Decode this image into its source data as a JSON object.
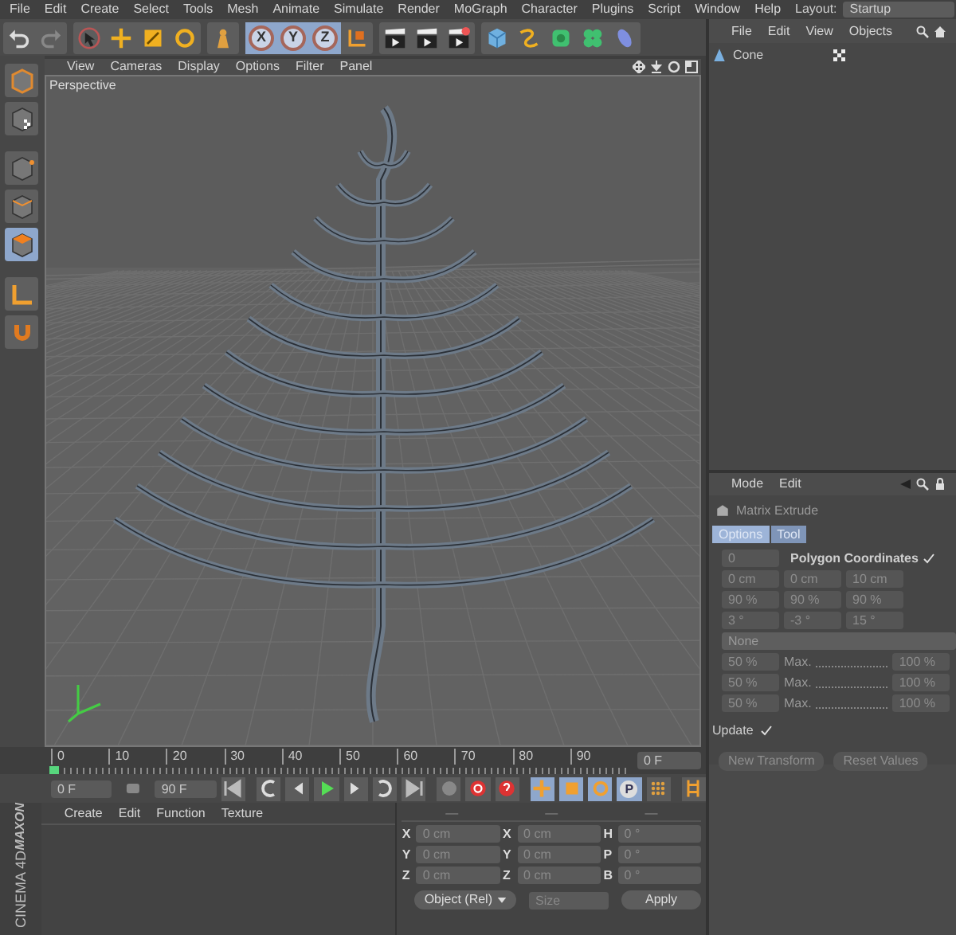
{
  "menu_bar": [
    "File",
    "Edit",
    "Create",
    "Select",
    "Tools",
    "Mesh",
    "Animate",
    "Simulate",
    "Render",
    "MoGraph",
    "Character",
    "Plugins",
    "Script",
    "Window",
    "Help"
  ],
  "layout": {
    "label": "Layout:",
    "value": "Startup"
  },
  "axis_locks": [
    {
      "label": "X",
      "on": true
    },
    {
      "label": "Y",
      "on": true
    },
    {
      "label": "Z",
      "on": true
    }
  ],
  "mode_tools": [
    {
      "kind": "model",
      "selected": false
    },
    {
      "kind": "texture",
      "selected": false
    },
    {
      "kind": "point",
      "selected": false
    },
    {
      "kind": "edge",
      "selected": false
    },
    {
      "kind": "polygon",
      "selected": true
    },
    {
      "kind": "axis",
      "selected": false
    },
    {
      "kind": "snap",
      "selected": false
    }
  ],
  "viewport": {
    "menu": [
      "View",
      "Cameras",
      "Display",
      "Options",
      "Filter",
      "Panel"
    ],
    "camera": "Perspective"
  },
  "object_manager": {
    "menu": [
      "File",
      "Edit",
      "View",
      "Objects"
    ],
    "objects": [
      {
        "name": "Cone"
      }
    ]
  },
  "attributes": {
    "menu": [
      "Mode",
      "Edit"
    ],
    "tool": "Matrix Extrude",
    "tabs": [
      {
        "label": "Options",
        "selected": true
      },
      {
        "label": "Tool",
        "selected": false
      }
    ],
    "rows": [
      {
        "kind": "field_check",
        "value": "0",
        "label": "Polygon Coordinates",
        "checked": true
      },
      {
        "kind": "fields",
        "values": [
          "0 cm",
          "0 cm",
          "10 cm"
        ]
      },
      {
        "kind": "fields",
        "values": [
          "90 %",
          "90 %",
          "90 %"
        ]
      },
      {
        "kind": "fields",
        "values": [
          "3 °",
          "-3 °",
          "15 °"
        ]
      },
      {
        "kind": "dropdown",
        "value": "None"
      },
      {
        "kind": "range",
        "min": "50 %",
        "label": "Max.",
        "max": "100 %"
      },
      {
        "kind": "range",
        "min": "50 %",
        "label": "Max.",
        "max": "100 %"
      },
      {
        "kind": "range",
        "min": "50 %",
        "label": "Max.",
        "max": "100 %"
      }
    ],
    "update": {
      "label": "Update",
      "checked": true
    },
    "buttons": [
      "New Transform",
      "Reset Values"
    ]
  },
  "timeline": {
    "ticks": [
      "0",
      "10",
      "20",
      "30",
      "40",
      "50",
      "60",
      "70",
      "80",
      "90"
    ],
    "playhead": {
      "level": 0
    },
    "current_frame": "0 F"
  },
  "transport": {
    "start": "0 F",
    "end": "90 F",
    "parameter_key": "P"
  },
  "material_manager": {
    "menu": [
      "Create",
      "Edit",
      "Function",
      "Texture"
    ]
  },
  "logo": {
    "brand": "MAXON",
    "product": "CINEMA 4D"
  },
  "coordinates": {
    "headers": [
      "—",
      "—",
      "—"
    ],
    "rows": [
      {
        "axis": "X",
        "position": "0 cm",
        "size_axis": "X",
        "size": "0 cm",
        "rot_axis": "H",
        "rotation": "0 °"
      },
      {
        "axis": "Y",
        "position": "0 cm",
        "size_axis": "Y",
        "size": "0 cm",
        "rot_axis": "P",
        "rotation": "0 °"
      },
      {
        "axis": "Z",
        "position": "0 cm",
        "size_axis": "Z",
        "size": "0 cm",
        "rot_axis": "B",
        "rotation": "0 °"
      }
    ],
    "mode": "Object (Rel)",
    "size_mode": "Size",
    "apply": "Apply"
  }
}
